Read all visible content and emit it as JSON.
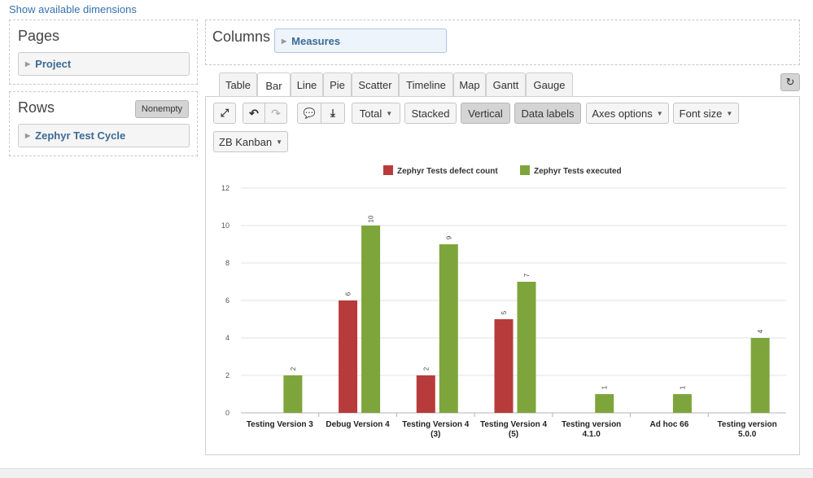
{
  "header": {
    "show_dimensions": "Show available dimensions"
  },
  "pages": {
    "title": "Pages",
    "item": "Project"
  },
  "rows": {
    "title": "Rows",
    "nonempty": "Nonempty",
    "item": "Zephyr Test Cycle"
  },
  "columns": {
    "title": "Columns",
    "item": "Measures"
  },
  "tabs": [
    "Table",
    "Bar",
    "Line",
    "Pie",
    "Scatter",
    "Timeline",
    "Map",
    "Gantt",
    "Gauge"
  ],
  "active_tab": "Bar",
  "toolbar": {
    "total": "Total",
    "stacked": "Stacked",
    "vertical": "Vertical",
    "data_labels": "Data labels",
    "axes_options": "Axes options",
    "font_size": "Font size",
    "zb_kanban": "ZB Kanban"
  },
  "icons": {
    "fullscreen": "fullscreen-icon",
    "undo": "undo-icon",
    "redo": "redo-icon",
    "comment": "comment-icon",
    "download": "download-icon",
    "refresh": "refresh-icon"
  },
  "chart_data": {
    "type": "bar",
    "categories": [
      [
        "Testing Version 3"
      ],
      [
        "Debug Version 4"
      ],
      [
        "Testing Version 4",
        "(3)"
      ],
      [
        "Testing Version 4",
        "(5)"
      ],
      [
        "Testing version",
        "4.1.0"
      ],
      [
        "Ad hoc 66"
      ],
      [
        "Testing version",
        "5.0.0"
      ]
    ],
    "series": [
      {
        "name": "Zephyr Tests defect count",
        "color": "#b83b3b",
        "values": [
          null,
          6,
          2,
          5,
          null,
          null,
          null
        ]
      },
      {
        "name": "Zephyr Tests executed",
        "color": "#7ea53c",
        "values": [
          2,
          10,
          9,
          7,
          1,
          1,
          4
        ]
      }
    ],
    "yticks": [
      0,
      2,
      4,
      6,
      8,
      10,
      12
    ],
    "ylim": [
      0,
      12
    ],
    "grid": true,
    "data_labels": true,
    "legend": "top"
  }
}
